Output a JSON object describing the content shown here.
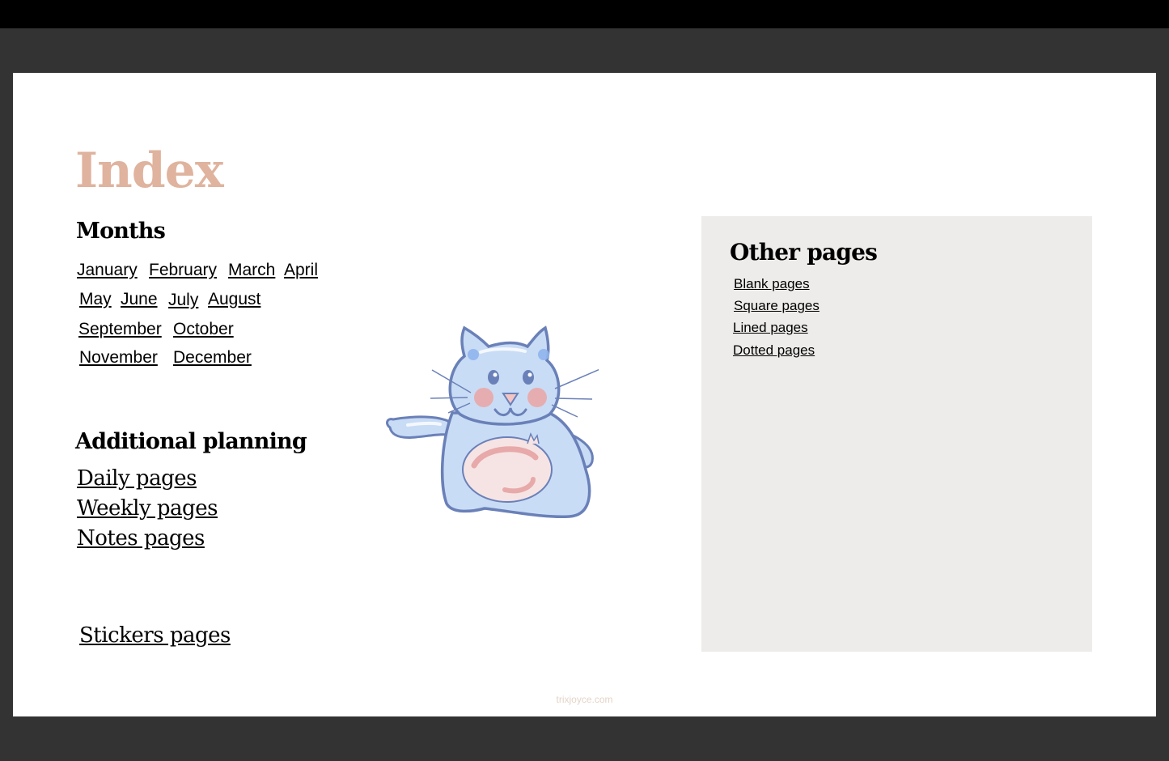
{
  "page": {
    "title": "Index",
    "footer": "trixjoyce.com",
    "accent_color": "#dfb39e"
  },
  "months": {
    "heading": "Months",
    "items": [
      "January",
      "February",
      "March",
      "April",
      "May",
      "June",
      "July",
      "August",
      "September",
      "October",
      "November",
      "December"
    ]
  },
  "additional": {
    "heading": "Additional planning",
    "items": [
      "Daily pages",
      "Weekly pages",
      "Notes pages"
    ],
    "stickers": "Stickers pages"
  },
  "other": {
    "heading": "Other pages",
    "items": [
      "Blank pages",
      "Square pages",
      "Lined pages",
      "Dotted pages"
    ]
  },
  "illustration": {
    "icon": "cat-illustration"
  }
}
